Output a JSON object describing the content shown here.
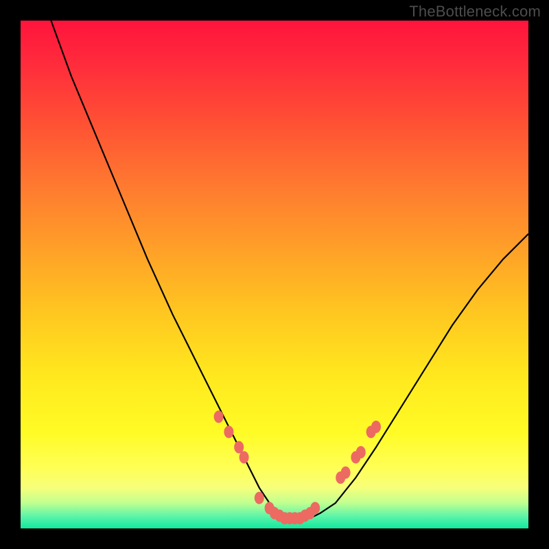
{
  "watermark": {
    "text": "TheBottleneck.com"
  },
  "chart_data": {
    "type": "line",
    "title": "",
    "xlabel": "",
    "ylabel": "",
    "xlim": [
      0,
      100
    ],
    "ylim": [
      0,
      100
    ],
    "grid": false,
    "legend": false,
    "annotations": [],
    "series": [
      {
        "name": "curve",
        "x": [
          6,
          10,
          15,
          20,
          25,
          30,
          35,
          40,
          43,
          45,
          47,
          49,
          51,
          53,
          55,
          57,
          59,
          62,
          66,
          70,
          75,
          80,
          85,
          90,
          95,
          100
        ],
        "y": [
          100,
          89,
          77,
          65,
          53,
          42,
          32,
          22,
          16,
          12,
          8,
          5,
          3,
          2,
          2,
          2,
          3,
          5,
          10,
          16,
          24,
          32,
          40,
          47,
          53,
          58
        ]
      },
      {
        "name": "markers-left-cluster",
        "x": [
          39,
          41,
          43,
          44
        ],
        "y": [
          22,
          19,
          16,
          14
        ]
      },
      {
        "name": "markers-bottom-cluster",
        "x": [
          47,
          49,
          50,
          51,
          52,
          53,
          54,
          55,
          56,
          57,
          58
        ],
        "y": [
          6,
          4,
          3,
          2.5,
          2,
          2,
          2,
          2,
          2.5,
          3,
          4
        ]
      },
      {
        "name": "markers-right-cluster",
        "x": [
          63,
          64,
          66,
          67,
          69,
          70
        ],
        "y": [
          10,
          11,
          14,
          15,
          19,
          20
        ]
      }
    ],
    "colors": {
      "curve": "#000000",
      "markers": "#ec6a62",
      "background_gradient_top": "#ff143c",
      "background_gradient_bottom": "#10e8a0"
    }
  }
}
